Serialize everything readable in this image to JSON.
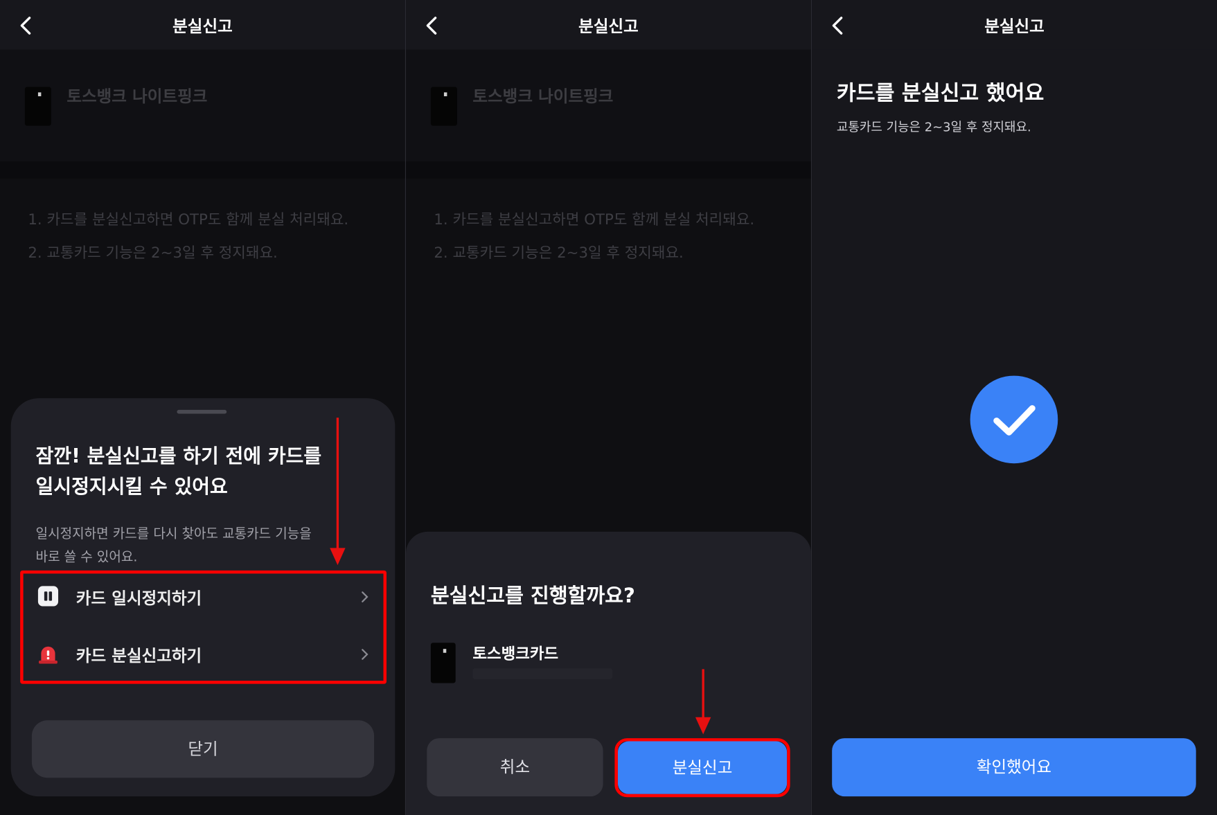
{
  "panels": [
    {
      "header_title": "분실신고",
      "card_name": "토스뱅크 나이트핑크",
      "notes": [
        "1.  카드를 분실신고하면 OTP도 함께 분실 처리돼요.",
        "2.  교통카드 기능은 2~3일 후 정지돼요."
      ],
      "sheet": {
        "title_line1": "잠깐! 분실신고를 하기 전에 카드를",
        "title_line2": "일시정지시킬 수 있어요",
        "desc_line1": "일시정지하면 카드를 다시 찾아도 교통카드 기능을",
        "desc_line2": "바로 쓸 수 있어요.",
        "options": [
          {
            "label": "카드 일시정지하기",
            "icon": "pause-icon"
          },
          {
            "label": "카드 분실신고하기",
            "icon": "siren-icon"
          }
        ],
        "close_label": "닫기"
      }
    },
    {
      "header_title": "분실신고",
      "card_name": "토스뱅크 나이트핑크",
      "notes": [
        "1.  카드를 분실신고하면 OTP도 함께 분실 처리돼요.",
        "2.  교통카드 기능은 2~3일 후 정지돼요."
      ],
      "dialog": {
        "title": "분실신고를 진행할까요?",
        "card_name": "토스뱅크카드",
        "cancel_label": "취소",
        "confirm_label": "분실신고"
      }
    },
    {
      "header_title": "분실신고",
      "headline": "카드를 분실신고 했어요",
      "subtext": "교통카드 기능은 2~3일 후 정지돼요.",
      "confirm_label": "확인했어요"
    }
  ],
  "colors": {
    "accent": "#3a82f7",
    "highlight": "#ff0000",
    "background": "#17171c",
    "sheet": "#202027"
  }
}
